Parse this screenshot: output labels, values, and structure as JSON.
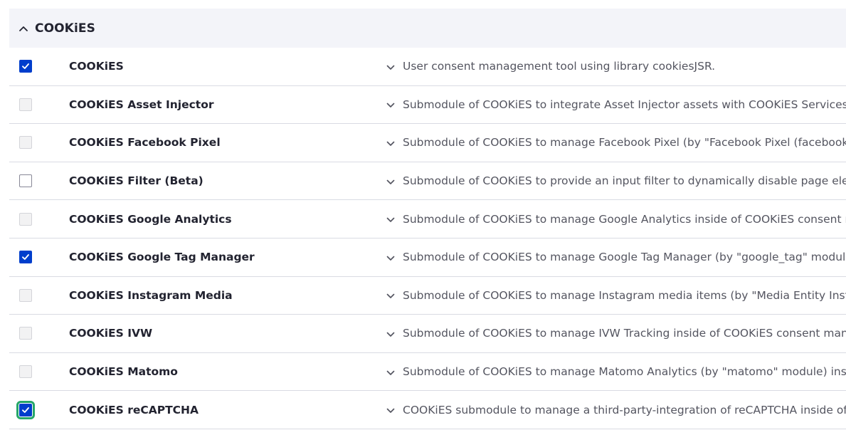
{
  "section": {
    "title": "COOKiES",
    "expanded": true
  },
  "modules": [
    {
      "name": "COOKiES",
      "description": "User consent management tool using library cookiesJSR.",
      "state": "checked"
    },
    {
      "name": "COOKiES Asset Injector",
      "description": "Submodule of COOKiES to integrate Asset Injector assets with COOKiES Services and i",
      "state": "disabled"
    },
    {
      "name": "COOKiES Facebook Pixel",
      "description": "Submodule of COOKiES to manage Facebook Pixel (by \"Facebook Pixel (facebook_pixe",
      "state": "disabled"
    },
    {
      "name": "COOKiES Filter (Beta)",
      "description": "Submodule of COOKiES to provide an input filter to dynamically disable page element",
      "state": "unchecked"
    },
    {
      "name": "COOKiES Google Analytics",
      "description": "Submodule of COOKiES to manage Google Analytics inside of COOKiES consent manag",
      "state": "disabled"
    },
    {
      "name": "COOKiES Google Tag Manager",
      "description": "Submodule of COOKiES to manage Google Tag Manager (by \"google_tag\" module) insi",
      "state": "checked"
    },
    {
      "name": "COOKiES Instagram Media",
      "description": "Submodule of COOKiES to manage Instagram media items (by \"Media Entity Instagram",
      "state": "disabled"
    },
    {
      "name": "COOKiES IVW",
      "description": "Submodule of COOKiES to manage IVW Tracking inside of COOKiES consent managem",
      "state": "disabled"
    },
    {
      "name": "COOKiES Matomo",
      "description": "Submodule of COOKiES to manage Matomo Analytics (by \"matomo\" module) inside of",
      "state": "disabled"
    },
    {
      "name": "COOKiES reCAPTCHA",
      "description": "COOKiES submodule to manage a third-party-integration of reCAPTCHA inside of COC",
      "state": "checked-focused"
    }
  ],
  "icons": {
    "section_toggle": "chevron-up-icon",
    "description_toggle": "chevron-down-icon",
    "checkmark": "checkmark-icon"
  },
  "colors": {
    "checked": "#003ecc",
    "focus": "#26a769",
    "header_bg": "#f3f4f9"
  }
}
